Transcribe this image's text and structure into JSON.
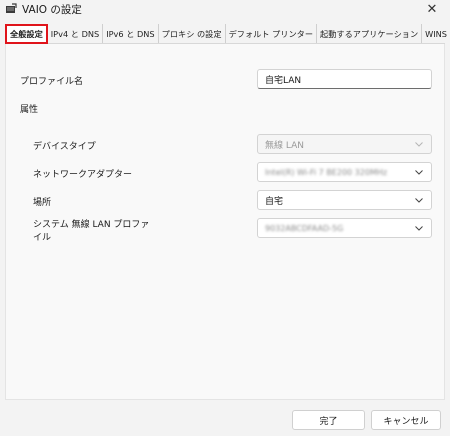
{
  "window": {
    "title": "VAIO の設定",
    "close_label": "✕"
  },
  "tabs": [
    {
      "label": "全般設定",
      "active": true
    },
    {
      "label": "IPv4 と DNS"
    },
    {
      "label": "IPv6 と DNS"
    },
    {
      "label": "プロキシ の設定"
    },
    {
      "label": "デフォルト プリンター"
    },
    {
      "label": "起動するアプリケーション"
    },
    {
      "label": "WINS"
    }
  ],
  "form": {
    "profile_name": {
      "label": "プロファイル名",
      "value": "自宅LAN"
    },
    "attributes_heading": "属性",
    "device_type": {
      "label": "デバイスタイプ",
      "value": "無線 LAN",
      "disabled": true
    },
    "network_adapter": {
      "label": "ネットワークアダプター",
      "value": "Intel(R) Wi-Fi 7 BE200 320MHz"
    },
    "location": {
      "label": "場所",
      "value": "自宅"
    },
    "wireless_profile": {
      "label_line1": "システム 無線 LAN プロファ",
      "label_line2": "イル",
      "value": "9032ABCDFAAD-5G"
    }
  },
  "footer": {
    "ok_label": "完了",
    "cancel_label": "キャンセル"
  }
}
